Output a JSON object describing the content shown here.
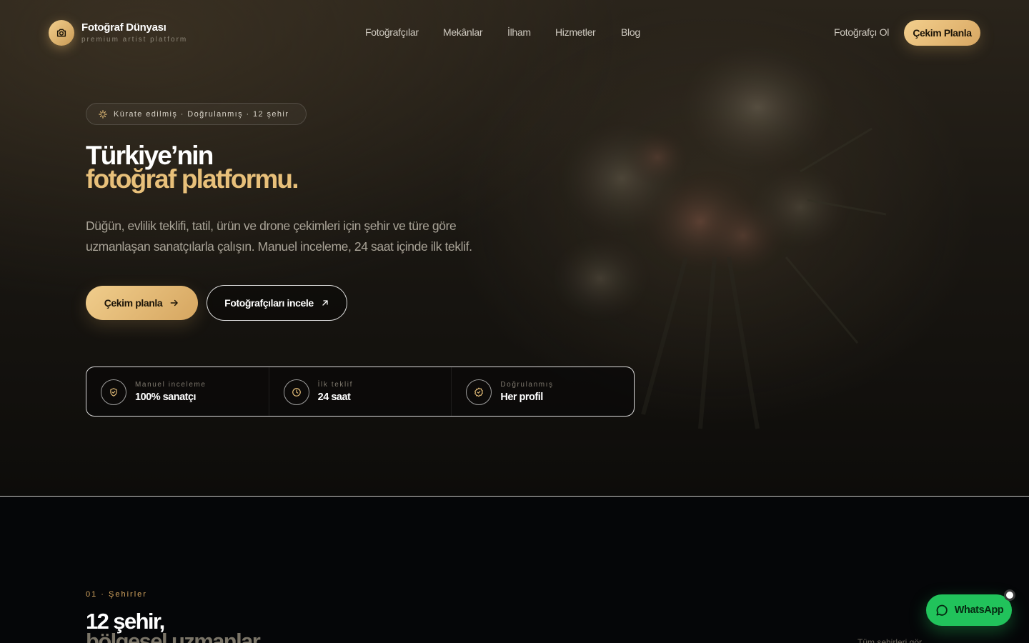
{
  "brand": {
    "name": "Fotoğraf Dünyası",
    "tagline": "premium artist platform",
    "logo_icon": "camera-icon"
  },
  "nav": {
    "links": [
      "Fotoğrafçılar",
      "Mekânlar",
      "İlham",
      "Hizmetler",
      "Blog"
    ],
    "become": "Fotoğrafçı Ol",
    "cta": "Çekim Planla"
  },
  "hero": {
    "badge": "Kürate edilmiş · Doğrulanmış · 12 şehir",
    "title_line1": "Türkiye’nin",
    "title_line2": "fotoğraf platformu.",
    "lead": "Düğün, evlilik teklifi, tatil, ürün ve drone çekimleri için şehir ve türe göre uzmanlaşan sanatçılarla çalışın. Manuel inceleme, 24 saat içinde ilk teklif.",
    "primary_button": "Çekim planla",
    "secondary_button": "Fotoğrafçıları incele"
  },
  "stats": [
    {
      "label": "Manuel inceleme",
      "value": "100% sanatçı",
      "icon": "shield-check-icon"
    },
    {
      "label": "İlk teklif",
      "value": "24 saat",
      "icon": "clock-icon"
    },
    {
      "label": "Doğrulanmış",
      "value": "Her profil",
      "icon": "verified-badge-icon"
    }
  ],
  "section_cities": {
    "eyebrow": "01 · Şehirler",
    "title_line1": "12 şehir,",
    "title_line2": "bölgesel uzmanlar.",
    "link": "Tüm şehirleri gör"
  },
  "whatsapp": {
    "label": "WhatsApp"
  },
  "colors": {
    "accent": "#e8c07a",
    "background": "#050608",
    "whatsapp": "#21c35b"
  }
}
